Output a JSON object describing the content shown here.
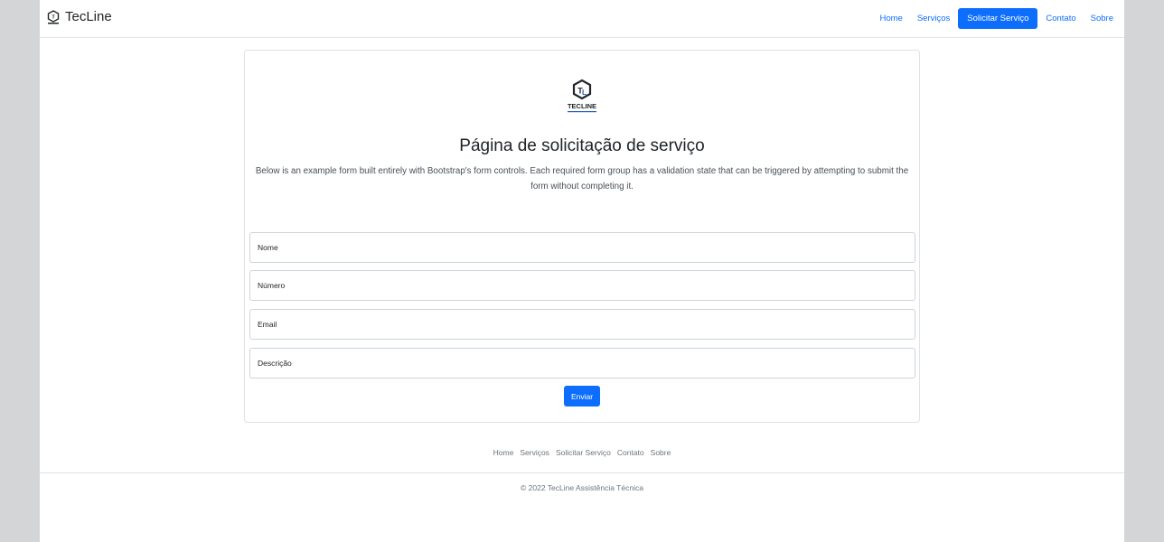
{
  "navbar": {
    "brand": "TecLine",
    "links": [
      {
        "label": "Home",
        "active": false
      },
      {
        "label": "Serviços",
        "active": false
      },
      {
        "label": "Solicitar Serviço",
        "active": true
      },
      {
        "label": "Contato",
        "active": false
      },
      {
        "label": "Sobre",
        "active": false
      }
    ]
  },
  "main": {
    "logo_text": "TECLINE",
    "title": "Página de solicitação de serviço",
    "description": "Below is an example form built entirely with Bootstrap's form controls. Each required form group has a validation state that can be triggered by attempting to submit the form without completing it.",
    "form": {
      "name_placeholder": "Nome",
      "number_placeholder": "Número",
      "email_placeholder": "Email",
      "description_placeholder": "Descrição",
      "submit_label": "Enviar"
    }
  },
  "footer": {
    "links": [
      "Home",
      "Serviços",
      "Solicitar Serviço",
      "Contato",
      "Sobre"
    ],
    "copyright": "© 2022 TecLine Assistência Técnica"
  },
  "colors": {
    "primary": "#0d6efd",
    "logo_dark": "#212529",
    "logo_accent": "#1e5bbf",
    "background": "#d4d5d7"
  }
}
